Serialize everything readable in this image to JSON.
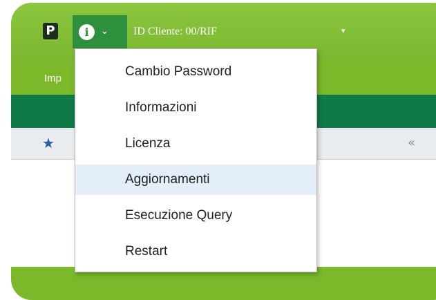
{
  "header": {
    "app_logo_glyph": "P",
    "info_glyph": "i",
    "info_chevron": "⌄",
    "client_label": "ID Cliente:  00/RIF",
    "client_caret": "▾"
  },
  "ribbon": {
    "tab_label": "Imp"
  },
  "toolbar": {
    "star_glyph": "★",
    "collapse_glyph": "«"
  },
  "menu": {
    "items": [
      {
        "label": "Cambio Password"
      },
      {
        "label": "Informazioni"
      },
      {
        "label": "Licenza"
      },
      {
        "label": "Aggiornamenti",
        "highlighted": true
      },
      {
        "label": "Esecuzione Query"
      },
      {
        "label": "Restart"
      }
    ]
  },
  "colors": {
    "topbar_green": "#7bb82a",
    "info_button_green": "#2e8f3c",
    "ribbon_dark_green": "#0e7a46",
    "menu_highlight": "#e3eef8",
    "star_blue": "#2a5fa6"
  },
  "icons": {
    "app_logo": "app-logo-icon",
    "info": "info-icon",
    "chevron": "chevron-down-icon",
    "caret": "caret-down-icon",
    "star": "star-icon",
    "collapse": "double-chevron-left-icon"
  }
}
